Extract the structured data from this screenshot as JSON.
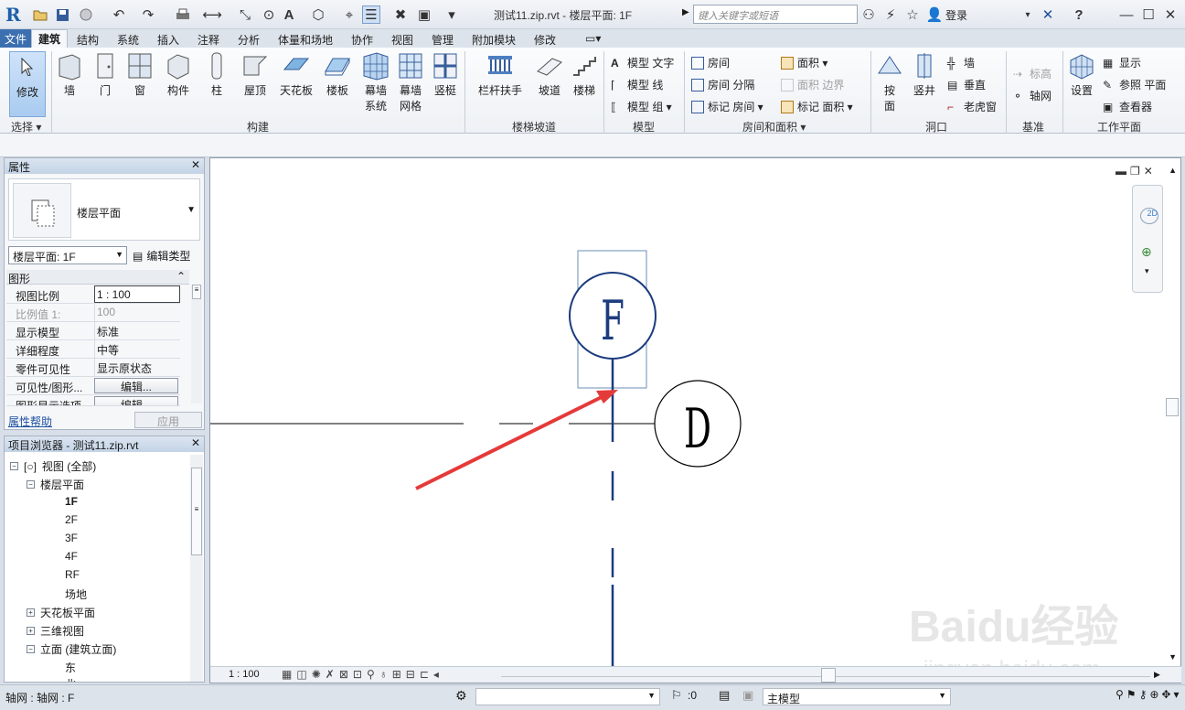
{
  "titlebar": {
    "title": "测试11.zip.rvt - 楼层平面: 1F",
    "search_placeholder": "键入关键字或短语",
    "login": "登录"
  },
  "menu": {
    "tabs": [
      "文件",
      "建筑",
      "结构",
      "系统",
      "插入",
      "注释",
      "分析",
      "体量和场地",
      "协作",
      "视图",
      "管理",
      "附加模块",
      "修改"
    ],
    "active": "建筑"
  },
  "ribbon": {
    "modify": "修改",
    "select": "选择",
    "build_tools": [
      "墙",
      "门",
      "窗",
      "构件",
      "柱",
      "屋顶",
      "天花板",
      "楼板"
    ],
    "curtain_system": [
      "幕墙",
      "系统"
    ],
    "curtain_grid": [
      "幕墙",
      "网格"
    ],
    "mullion": "竖梃",
    "build_panel": "构建",
    "railing": "栏杆扶手",
    "ramp": "坡道",
    "stair": "楼梯",
    "circulation_panel": "楼梯坡道",
    "model_text": "模型 文字",
    "model_line": "模型 线",
    "model_group": "模型 组",
    "model_panel": "模型",
    "room": "房间",
    "room_separator": "房间 分隔",
    "tag_room": "标记 房间",
    "area": "面积",
    "area_boundary": "面积 边界",
    "tag_area": "标记 面积",
    "room_panel": "房间和面积",
    "by_face": [
      "按",
      "面"
    ],
    "shaft": "竖井",
    "wall_opening": "墙",
    "vertical": "垂直",
    "dormer": "老虎窗",
    "opening_panel": "洞口",
    "level": "标高",
    "grid": "轴网",
    "datum_panel": "基准",
    "set": "设置",
    "show": "显示",
    "ref_plane": "参照 平面",
    "viewer": "查看器",
    "workplane_panel": "工作平面"
  },
  "properties": {
    "title": "属性",
    "type_name": "楼层平面",
    "view_select": "楼层平面: 1F",
    "edit_type": "编辑类型",
    "group": "图形",
    "rows": [
      {
        "k": "视图比例",
        "v": "1 : 100"
      },
      {
        "k": "比例值 1:",
        "v": "100"
      },
      {
        "k": "显示模型",
        "v": "标准"
      },
      {
        "k": "详细程度",
        "v": "中等"
      },
      {
        "k": "零件可见性",
        "v": "显示原状态"
      },
      {
        "k": "可见性/图形...",
        "v": "编辑..."
      },
      {
        "k": "图形显示选项",
        "v": "编辑..."
      }
    ],
    "help": "属性帮助",
    "apply": "应用"
  },
  "browser": {
    "title": "项目浏览器 - 测试11.zip.rvt",
    "root": "视图 (全部)",
    "floor_plans": "楼层平面",
    "levels": [
      "1F",
      "2F",
      "3F",
      "4F",
      "RF",
      "场地"
    ],
    "ceiling": "天花板平面",
    "three_d": "三维视图",
    "elevations": "立面 (建筑立面)",
    "east": "东",
    "north": "北"
  },
  "canvas": {
    "grid_f": "F",
    "grid_d": "D",
    "scale": "1 : 100",
    "watermark": "Baidu经验",
    "watermark_url": "jingyan.baidu.com"
  },
  "statusbar": {
    "text": "轴网 : 轴网 : F",
    "zero": ":0",
    "model": "主模型"
  }
}
